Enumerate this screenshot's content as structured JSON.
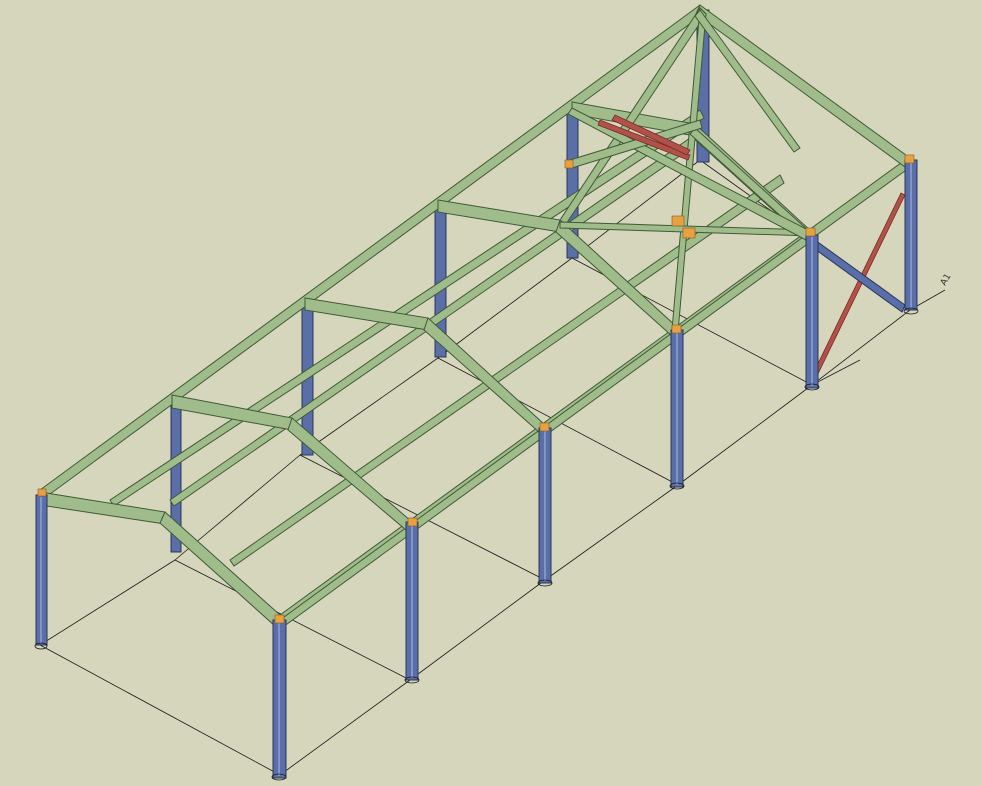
{
  "viewport": {
    "background_color": "#d6d6bc",
    "grid_label": "A1"
  },
  "colors": {
    "column_steel": "#5a6ea8",
    "column_edge": "#2a3558",
    "beam_steel": "#9fbc8a",
    "beam_edge": "#3f5a36",
    "bracing_red": "#b0524a",
    "connection_plate": "#e8a040",
    "grid_line": "#1a1a1a"
  },
  "model": {
    "columns": [
      {
        "name": "column-left-end-eave",
        "bay": "end"
      },
      {
        "name": "column-front-end",
        "bay": "end"
      },
      {
        "name": "column-front-2",
        "bay": "mid"
      },
      {
        "name": "column-front-3",
        "bay": "mid"
      },
      {
        "name": "column-front-4",
        "bay": "mid"
      },
      {
        "name": "column-front-5",
        "bay": "mid"
      },
      {
        "name": "column-right-end",
        "bay": "end"
      },
      {
        "name": "column-back-2",
        "bay": "mid"
      },
      {
        "name": "column-back-3",
        "bay": "mid"
      },
      {
        "name": "column-back-4",
        "bay": "mid"
      },
      {
        "name": "column-back-5",
        "bay": "mid"
      }
    ]
  }
}
